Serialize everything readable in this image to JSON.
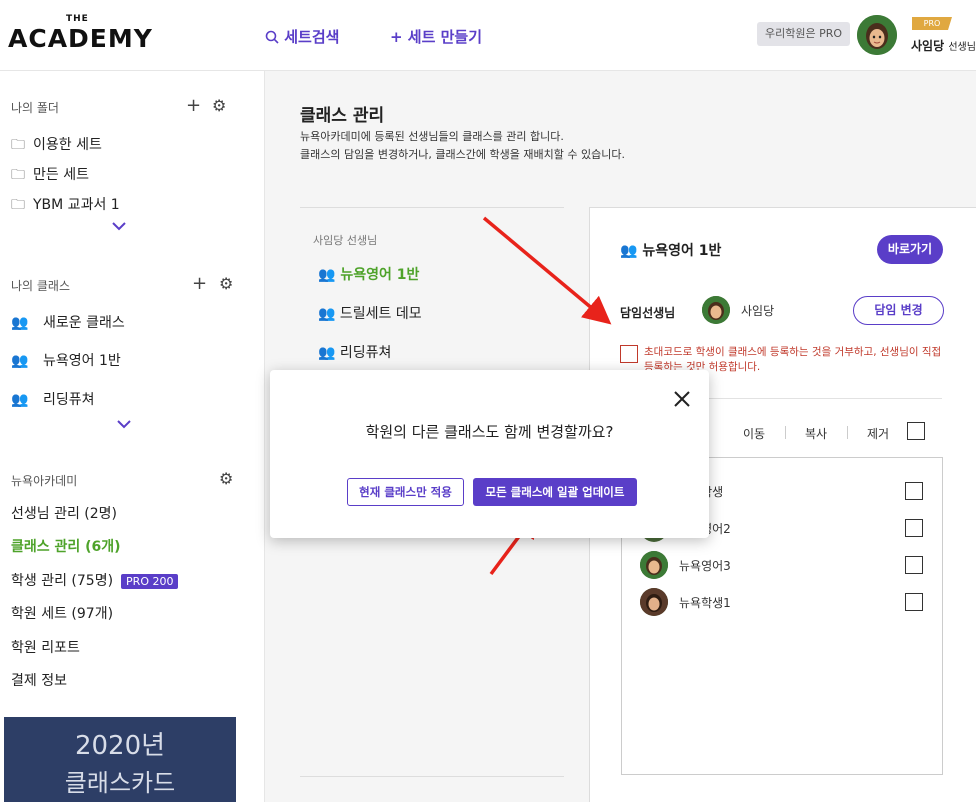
{
  "header": {
    "logo_top": "THE",
    "logo_name": "ACADEMY",
    "nav_search": "세트검색",
    "nav_create": "+ 세트 만들기",
    "pro_chip": "우리학원은 PRO",
    "pro_tag": "PRO",
    "user_name": "사임당",
    "user_suffix": "선생님"
  },
  "sidebar": {
    "folders_title": "나의 폴더",
    "folders": [
      "이용한 세트",
      "만든 세트",
      "YBM 교과서 1"
    ],
    "classes_title": "나의 클래스",
    "classes": [
      "새로운 클래스",
      "뉴욕영어 1반",
      "리딩퓨쳐"
    ],
    "academy_title": "뉴욕아카데미",
    "academy_links": [
      "선생님 관리 (2명)",
      "클래스 관리 (6개)",
      "학생 관리 (75명)",
      "학원 세트 (97개)",
      "학원 리포트",
      "결제 정보"
    ],
    "pro200": "PRO 200",
    "banner_line1": "2020년",
    "banner_line2": "클래스카드"
  },
  "main": {
    "title": "클래스 관리",
    "desc1": "뉴욕아카데미에 등록된 선생님들의 클래스를 관리 합니다.",
    "desc2": "클래스의 담임을 변경하거나, 클래스간에 학생을 재배치할 수 있습니다.",
    "teacher_label": "사임당 선생님",
    "class_list": [
      "뉴욕영어 1반",
      "드릴세트 데모",
      "리딩퓨쳐"
    ]
  },
  "card": {
    "title": "뉴욕영어 1반",
    "goto_button": "바로가기",
    "homeroom_label": "담임선생님",
    "homeroom_name": "사임당",
    "change_button": "담임 변경",
    "warning": "초대코드로 학생이 클래스에 등록하는 것을 거부하고, 선생님이 직접 등록하는 것만 허용합니다.",
    "actions": [
      "이동",
      "복사",
      "제거"
    ],
    "students": [
      "뉴욕학생",
      "뉴욕영어2",
      "뉴욕영어3",
      "뉴욕학생1"
    ]
  },
  "modal": {
    "question": "학원의 다른 클래스도 함께 변경할까요?",
    "btn_current": "현재 클래스만 적용",
    "btn_all": "모든 클래스에 일괄 업데이트"
  },
  "colors": {
    "accent": "#5a3ec8",
    "active_green": "#4ea32a",
    "warning_red": "#c0392b",
    "arrow_red": "#e8231b"
  }
}
